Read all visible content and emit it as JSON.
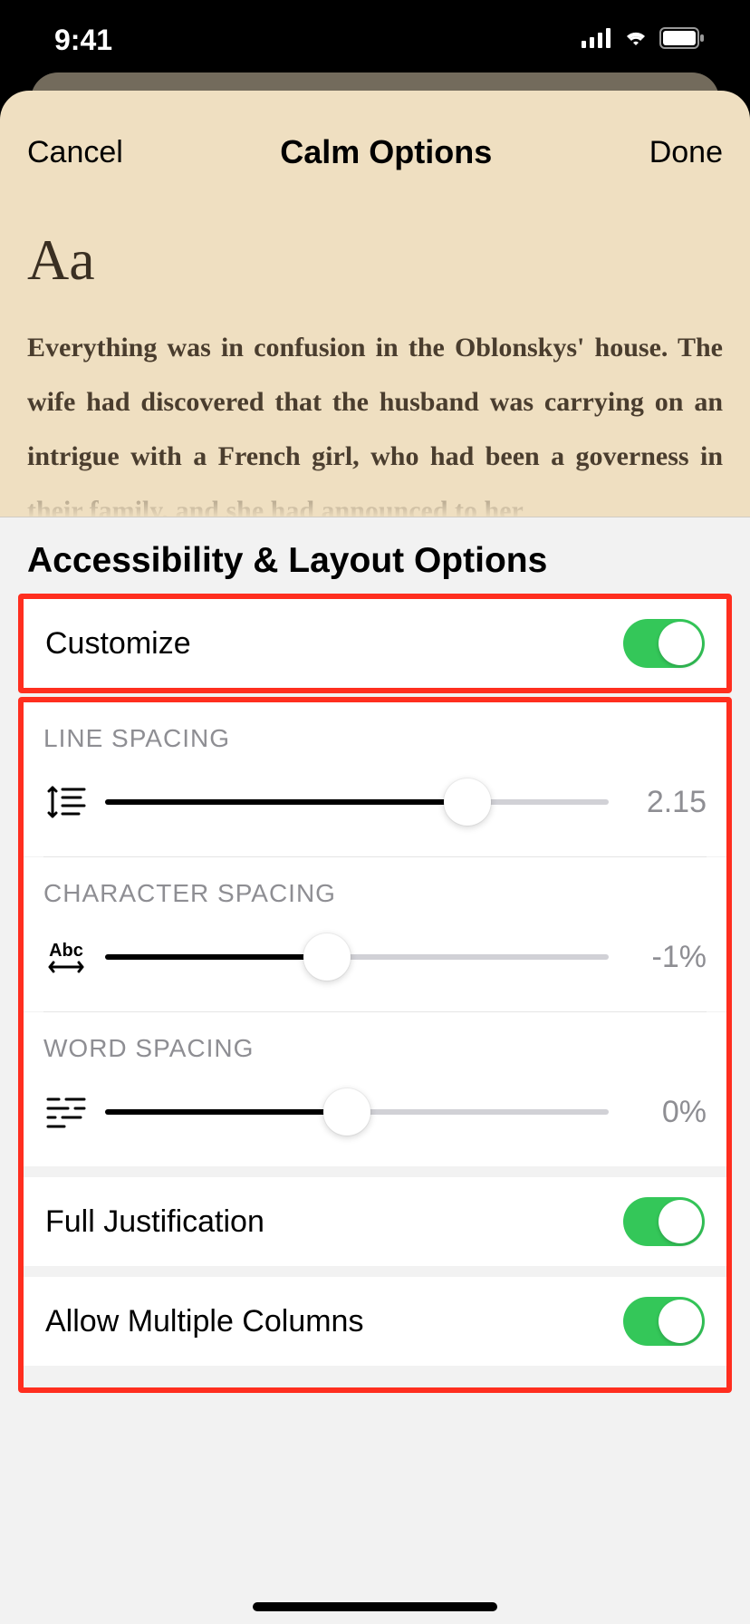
{
  "status": {
    "time": "9:41"
  },
  "header": {
    "cancel_label": "Cancel",
    "title": "Calm Options",
    "done_label": "Done"
  },
  "preview": {
    "aa_sample": "Aa",
    "body_text": "Everything was in confusion in the Oblonskys' house. The wife had discovered that the husband was carrying on an intrigue with a French girl, who had been a governess in their family, and she had announced to her"
  },
  "panel": {
    "title": "Accessibility & Layout Options",
    "customize": {
      "label": "Customize",
      "enabled": true
    },
    "line_spacing": {
      "label": "LINE SPACING",
      "value_display": "2.15",
      "fill_percent": 72
    },
    "character_spacing": {
      "label": "CHARACTER SPACING",
      "icon_text": "Abc",
      "value_display": "-1%",
      "fill_percent": 44
    },
    "word_spacing": {
      "label": "WORD SPACING",
      "value_display": "0%",
      "fill_percent": 48
    },
    "full_justification": {
      "label": "Full Justification",
      "enabled": true
    },
    "multiple_columns": {
      "label": "Allow Multiple Columns",
      "enabled": true
    }
  }
}
